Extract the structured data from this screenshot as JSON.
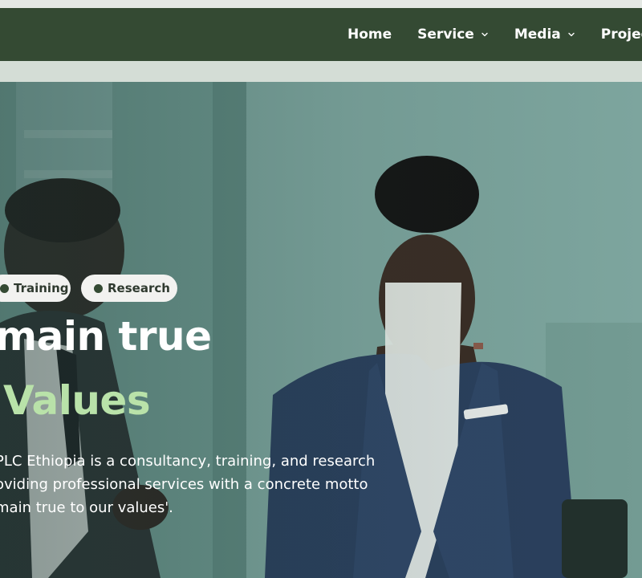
{
  "nav": {
    "items": [
      {
        "label": "Home",
        "dropdown": false
      },
      {
        "label": "Service",
        "dropdown": true
      },
      {
        "label": "Media",
        "dropdown": true
      },
      {
        "label": "Project",
        "dropdown": false
      }
    ]
  },
  "hero": {
    "tags": [
      "Training",
      "Research"
    ],
    "headline_line1": "main true",
    "headline_line2": "Values",
    "description_lines": [
      "PLC Ethiopia is a consultancy, training, and research",
      "oviding professional services with a concrete motto",
      "main true to our values'."
    ]
  },
  "colors": {
    "navbar": "#344a33",
    "accent_green": "#b9e2a9",
    "pill_bg": "#f2f2f0"
  }
}
